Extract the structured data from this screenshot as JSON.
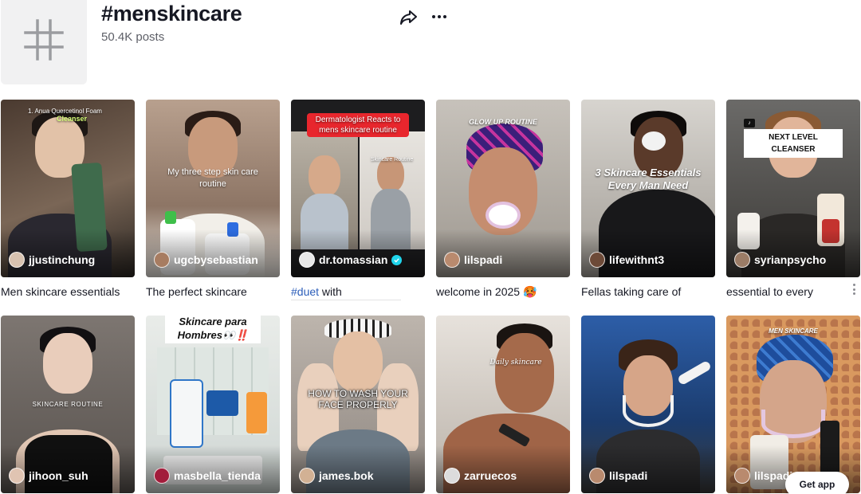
{
  "header": {
    "title": "#menskincare",
    "posts_count": "50.4K posts"
  },
  "videos": [
    {
      "creator": "jjustinchung",
      "caption": "Men skincare essentials",
      "overlay": [
        "1. Anua Quercetinol Foam",
        "Cleanser"
      ],
      "verified": false
    },
    {
      "creator": "ugcbysebastian",
      "caption": "The perfect skincare",
      "overlay": [
        "My three step skin care routine"
      ],
      "verified": false
    },
    {
      "creator": "dr.tomassian",
      "caption_hashtag": "#duet",
      "caption": " with",
      "overlay": [
        "Dermatologist Reacts to mens skincare routine",
        "Skincare Routine"
      ],
      "verified": true
    },
    {
      "creator": "lilspadi",
      "caption": "welcome in 2025 🥵",
      "overlay": [
        "GLOW UP ROUTINE"
      ],
      "verified": false
    },
    {
      "creator": "lifewithnt3",
      "caption": "Fellas taking care of",
      "overlay": [
        "3 Skincare Essentials Every Man Need"
      ],
      "verified": false
    },
    {
      "creator": "syrianpsycho",
      "caption": "essential to every",
      "overlay": [
        "NEXT LEVEL CLEANSER"
      ],
      "verified": false
    },
    {
      "creator": "jihoon_suh",
      "caption": "",
      "overlay": [
        "SKINCARE ROUTINE"
      ],
      "verified": false
    },
    {
      "creator": "masbella_tienda",
      "caption": "",
      "overlay": [
        "Skincare para Hombres👀‼️"
      ],
      "verified": false
    },
    {
      "creator": "james.bok",
      "caption": "",
      "overlay": [
        "HOW TO WASH YOUR FACE PROPERLY"
      ],
      "verified": false
    },
    {
      "creator": "zarruecos",
      "caption": "",
      "overlay": [
        "Daily skincare"
      ],
      "verified": false
    },
    {
      "creator": "lilspadi",
      "caption": "",
      "overlay": [],
      "verified": false
    },
    {
      "creator": "lilspadi",
      "caption": "",
      "overlay": [
        "MEN SKINCARE"
      ],
      "verified": false
    }
  ],
  "get_app_label": "Get app"
}
